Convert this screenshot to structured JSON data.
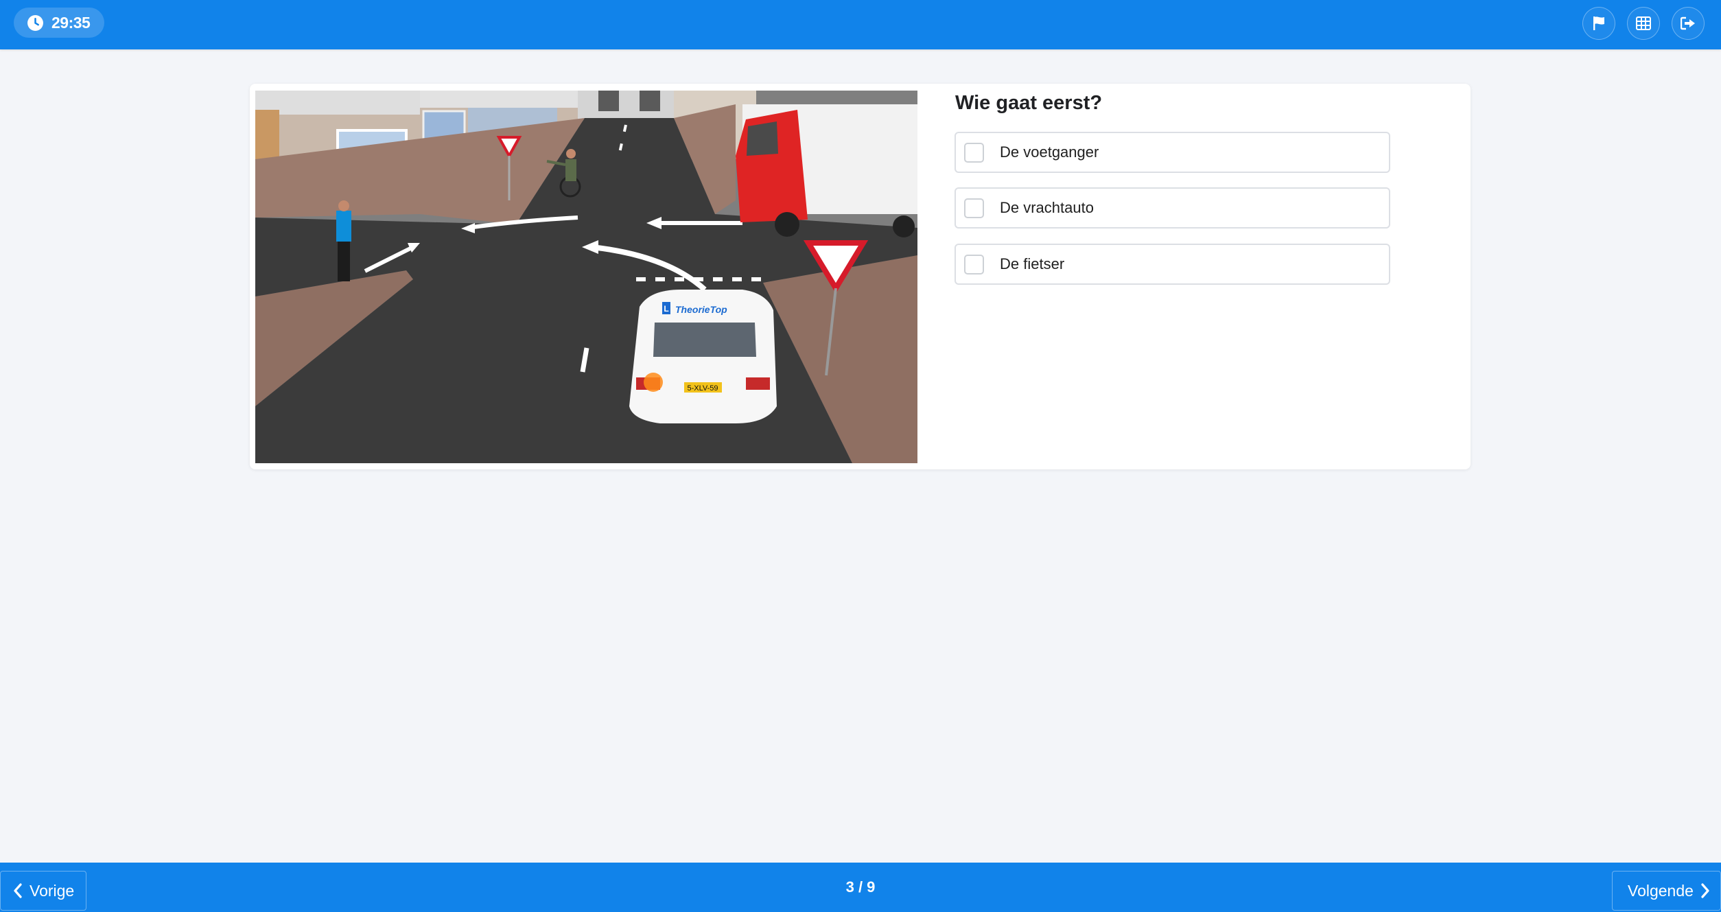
{
  "header": {
    "timer": "29:35",
    "icons": [
      "clock-icon",
      "flag-icon",
      "grid-icon",
      "exit-icon"
    ]
  },
  "question": {
    "title": "Wie gaat eerst?",
    "options": [
      {
        "label": "De voetganger",
        "checked": false
      },
      {
        "label": "De vrachtauto",
        "checked": false
      },
      {
        "label": "De fietser",
        "checked": false
      }
    ]
  },
  "scene": {
    "brand": "TheorieTop",
    "plate": "5-XLV-59",
    "l_mark": "L"
  },
  "footer": {
    "prev_label": "Vorige",
    "next_label": "Volgende",
    "progress": "3 / 9"
  },
  "colors": {
    "primary": "#1183ea",
    "background": "#f3f5f9"
  }
}
